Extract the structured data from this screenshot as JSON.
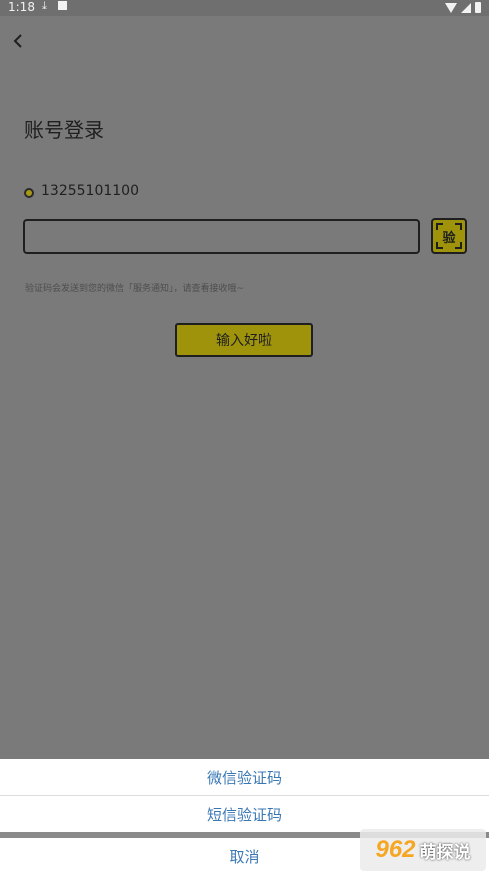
{
  "status_bar": {
    "time": "1:18",
    "icons": [
      "download-icon",
      "app-notification-icon",
      "wifi-icon",
      "signal-icon",
      "battery-icon"
    ]
  },
  "header": {
    "back_icon": "chevron-left-icon"
  },
  "login": {
    "title": "账号登录",
    "phone_number": "13255101100",
    "code_value": "",
    "scan_button_label": "验",
    "hint": "验证码会发送到您的微信「服务通知」，请查看接收哦~",
    "submit_label": "输入好啦"
  },
  "action_sheet": {
    "options": [
      "微信验证码",
      "短信验证码"
    ],
    "cancel_label": "取消"
  },
  "watermark": {
    "number": "962",
    "text": "萌探说"
  },
  "colors": {
    "accent": "#9f930c",
    "overlay": "#7a7a7a",
    "link": "#3a78b5"
  }
}
